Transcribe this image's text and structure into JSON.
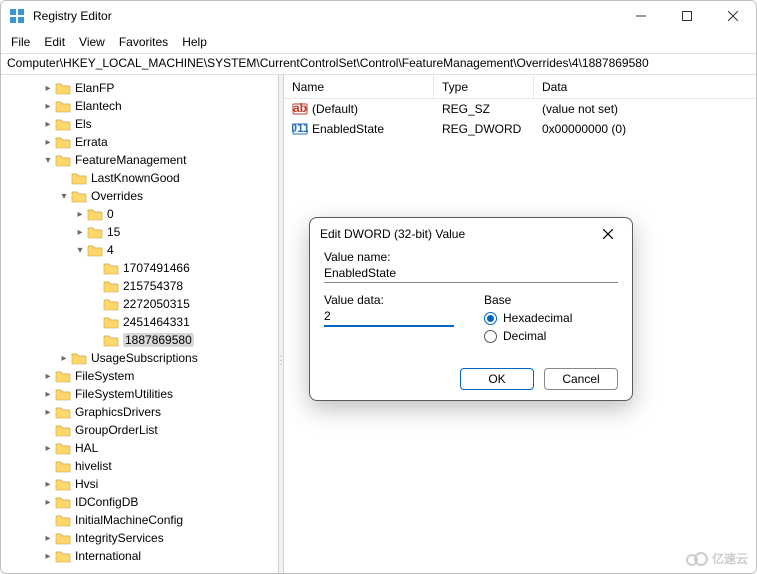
{
  "window": {
    "title": "Registry Editor"
  },
  "menu": {
    "file": "File",
    "edit": "Edit",
    "view": "View",
    "favorites": "Favorites",
    "help": "Help"
  },
  "address": "Computer\\HKEY_LOCAL_MACHINE\\SYSTEM\\CurrentControlSet\\Control\\FeatureManagement\\Overrides\\4\\1887869580",
  "tree": [
    {
      "indent": 40,
      "twisty": ">",
      "label": "ElanFP"
    },
    {
      "indent": 40,
      "twisty": ">",
      "label": "Elantech"
    },
    {
      "indent": 40,
      "twisty": ">",
      "label": "Els"
    },
    {
      "indent": 40,
      "twisty": ">",
      "label": "Errata"
    },
    {
      "indent": 40,
      "twisty": "v",
      "label": "FeatureManagement"
    },
    {
      "indent": 56,
      "twisty": "",
      "label": "LastKnownGood"
    },
    {
      "indent": 56,
      "twisty": "v",
      "label": "Overrides"
    },
    {
      "indent": 72,
      "twisty": ">",
      "label": "0"
    },
    {
      "indent": 72,
      "twisty": ">",
      "label": "15"
    },
    {
      "indent": 72,
      "twisty": "v",
      "label": "4"
    },
    {
      "indent": 88,
      "twisty": "",
      "label": "1707491466"
    },
    {
      "indent": 88,
      "twisty": "",
      "label": "215754378"
    },
    {
      "indent": 88,
      "twisty": "",
      "label": "2272050315"
    },
    {
      "indent": 88,
      "twisty": "",
      "label": "2451464331"
    },
    {
      "indent": 88,
      "twisty": "",
      "label": "1887869580",
      "selected": true
    },
    {
      "indent": 56,
      "twisty": ">",
      "label": "UsageSubscriptions"
    },
    {
      "indent": 40,
      "twisty": ">",
      "label": "FileSystem"
    },
    {
      "indent": 40,
      "twisty": ">",
      "label": "FileSystemUtilities"
    },
    {
      "indent": 40,
      "twisty": ">",
      "label": "GraphicsDrivers"
    },
    {
      "indent": 40,
      "twisty": "",
      "label": "GroupOrderList"
    },
    {
      "indent": 40,
      "twisty": ">",
      "label": "HAL"
    },
    {
      "indent": 40,
      "twisty": "",
      "label": "hivelist"
    },
    {
      "indent": 40,
      "twisty": ">",
      "label": "Hvsi"
    },
    {
      "indent": 40,
      "twisty": ">",
      "label": "IDConfigDB"
    },
    {
      "indent": 40,
      "twisty": "",
      "label": "InitialMachineConfig"
    },
    {
      "indent": 40,
      "twisty": ">",
      "label": "IntegrityServices"
    },
    {
      "indent": 40,
      "twisty": ">",
      "label": "International"
    }
  ],
  "list": {
    "headers": {
      "name": "Name",
      "type": "Type",
      "data": "Data"
    },
    "rows": [
      {
        "icon": "sz",
        "name": "(Default)",
        "type": "REG_SZ",
        "data": "(value not set)"
      },
      {
        "icon": "dw",
        "name": "EnabledState",
        "type": "REG_DWORD",
        "data": "0x00000000 (0)"
      }
    ]
  },
  "dialog": {
    "title": "Edit DWORD (32-bit) Value",
    "value_name_label": "Value name:",
    "value_name": "EnabledState",
    "value_data_label": "Value data:",
    "value_data": "2",
    "base_label": "Base",
    "hex_label": "Hexadecimal",
    "dec_label": "Decimal",
    "ok": "OK",
    "cancel": "Cancel"
  },
  "watermark": "亿速云"
}
